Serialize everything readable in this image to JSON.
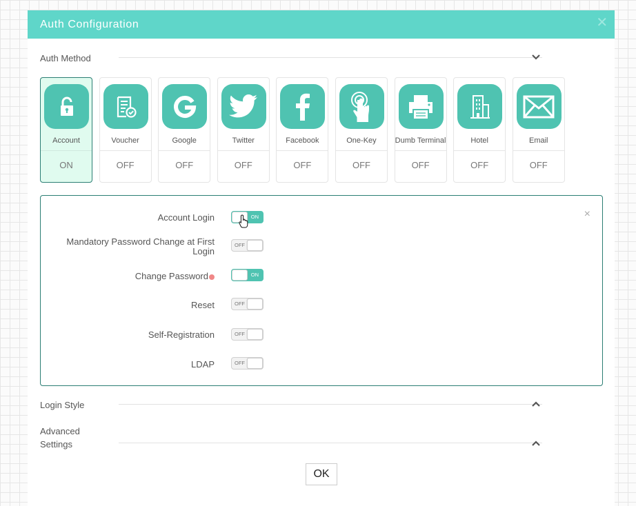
{
  "dialog": {
    "title": "Auth Configuration",
    "close_symbol": "✕"
  },
  "auth_method": {
    "label": "Auth Method",
    "methods": [
      {
        "label": "Account",
        "state": "ON",
        "icon": "lock-icon"
      },
      {
        "label": "Voucher",
        "state": "OFF",
        "icon": "voucher-icon"
      },
      {
        "label": "Google",
        "state": "OFF",
        "icon": "google-icon"
      },
      {
        "label": "Twitter",
        "state": "OFF",
        "icon": "twitter-icon"
      },
      {
        "label": "Facebook",
        "state": "OFF",
        "icon": "facebook-icon"
      },
      {
        "label": "One-Key",
        "state": "OFF",
        "icon": "one-key-icon"
      },
      {
        "label": "Dumb Terminal",
        "state": "OFF",
        "icon": "printer-icon"
      },
      {
        "label": "Hotel",
        "state": "OFF",
        "icon": "hotel-icon"
      },
      {
        "label": "Email",
        "state": "OFF",
        "icon": "email-icon"
      }
    ]
  },
  "account_panel": {
    "close_symbol": "×",
    "options": [
      {
        "label": "Account Login",
        "state": "on",
        "toggle_text": "ON"
      },
      {
        "label": "Mandatory Password Change at First Login",
        "state": "off",
        "toggle_text": "OFF"
      },
      {
        "label": "Change Password",
        "state": "on",
        "toggle_text": "ON"
      },
      {
        "label": "Reset",
        "state": "off",
        "toggle_text": "OFF"
      },
      {
        "label": "Self-Registration",
        "state": "off",
        "toggle_text": "OFF"
      },
      {
        "label": "LDAP",
        "state": "off",
        "toggle_text": "OFF"
      }
    ]
  },
  "login_style": {
    "label": "Login Style"
  },
  "advanced_settings": {
    "label": "Advanced Settings"
  },
  "ok_button": {
    "label": "OK"
  },
  "colors": {
    "header": "#5fd6c9",
    "accent": "#4fc3b1",
    "panel_border": "#2a7d73",
    "active_bg": "#e0fbef"
  }
}
